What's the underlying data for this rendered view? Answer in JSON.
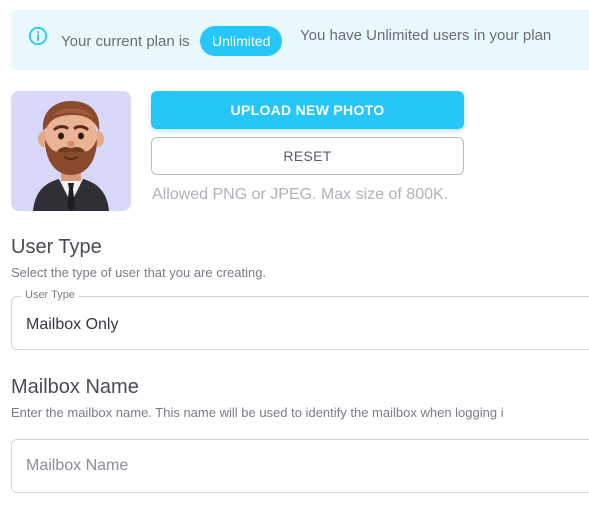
{
  "plan_banner": {
    "prefix": "Your current plan is",
    "plan_name": "Unlimited",
    "users_text": "You have Unlimited users in your plan",
    "icon": "info-icon",
    "accent_color": "#26c6f9",
    "background_color": "#e9f8fd"
  },
  "avatar": {
    "icon": "avatar-man-bearded",
    "background_color": "#d8d8fb"
  },
  "photo_actions": {
    "upload_label": "UPLOAD NEW PHOTO",
    "reset_label": "RESET",
    "allowed_text": "Allowed PNG or JPEG. Max size of 800K."
  },
  "user_type_section": {
    "title": "User Type",
    "description": "Select the type of user that you are creating.",
    "field_label": "User Type",
    "selected_value": "Mailbox Only"
  },
  "mailbox_section": {
    "title": "Mailbox Name",
    "description": "Enter the mailbox name. This name will be used to identify the mailbox when logging i",
    "placeholder": "Mailbox Name",
    "value": ""
  }
}
